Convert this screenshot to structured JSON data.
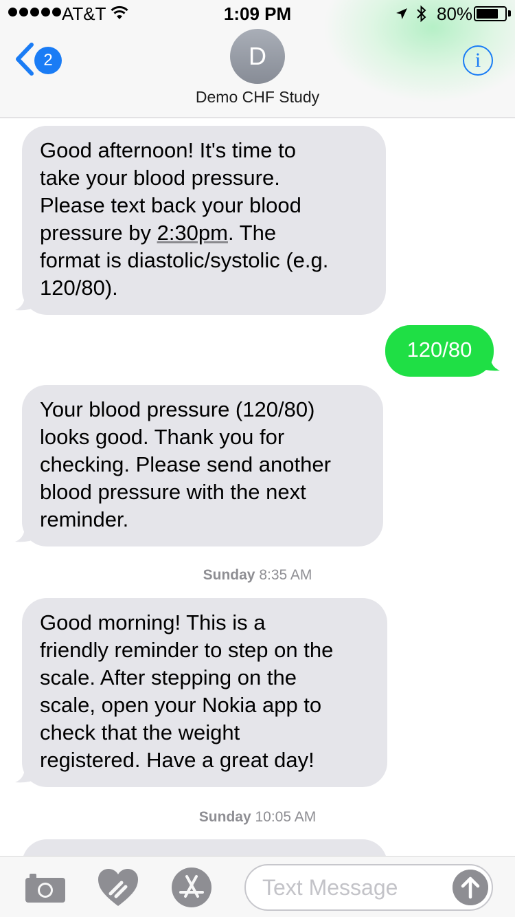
{
  "status_bar": {
    "carrier": "AT&T",
    "time": "1:09 PM",
    "battery": "80%",
    "battery_level": 0.8
  },
  "header": {
    "back_badge": "2",
    "avatar_initial": "D",
    "contact_name": "Demo CHF Study"
  },
  "messages": {
    "m1": {
      "line1": "Good afternoon! It's time to",
      "line2": "take your blood pressure.",
      "line3": "Please text back your blood",
      "line4_pre": "pressure by ",
      "line4_link": "2:30pm",
      "line4_post": ". The",
      "line5": "format is diastolic/systolic (e.g.",
      "line6": "120/80)."
    },
    "m2": {
      "text": "120/80"
    },
    "m3": {
      "line1": "Your blood pressure (120/80)",
      "line2": "looks good. Thank you for",
      "line3": "checking. Please send another",
      "line4": "blood pressure with the next",
      "line5": "reminder."
    },
    "ts1": {
      "day": "Sunday",
      "time": "8:35 AM"
    },
    "m4": {
      "line1": "Good morning! This is a",
      "line2": "friendly reminder to step on the",
      "line3": "scale. After stepping on the",
      "line4": "scale, open your Nokia app to",
      "line5": "check that the weight",
      "line6": "registered. Have a great day!"
    },
    "ts2": {
      "day": "Sunday",
      "time": "10:05 AM"
    }
  },
  "input_bar": {
    "placeholder": "Text Message"
  },
  "colors": {
    "ios_blue": "#1a7cf5",
    "sms_green": "#1fdf45",
    "incoming_gray": "#e5e5ea"
  }
}
